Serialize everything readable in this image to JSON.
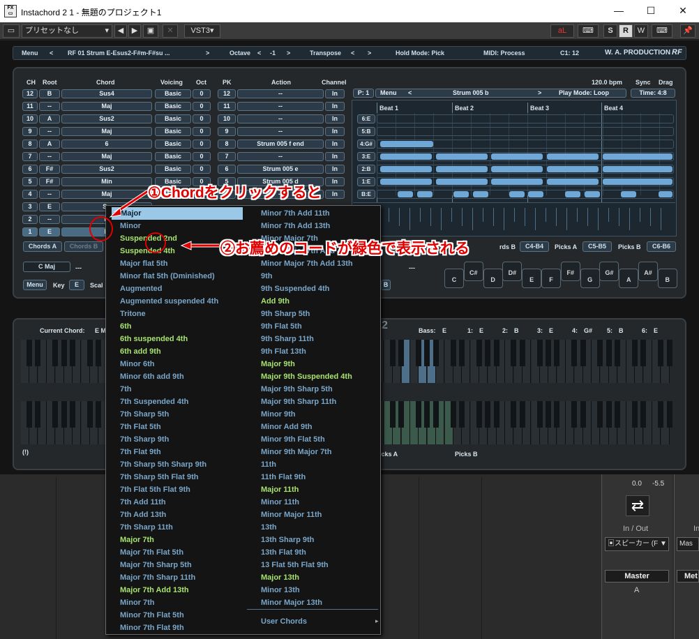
{
  "window": {
    "title": "Instachord 2 1 - 無題のプロジェクト1",
    "minimize": "—",
    "maximize": "☐",
    "close": "✕"
  },
  "toolbar": {
    "preset": "プリセットなし",
    "vst": "VST3▾",
    "s": "S",
    "r": "R",
    "w": "W"
  },
  "topstrip": {
    "menu": "Menu",
    "prev": "<",
    "preset": "RF 01 Strum E-Esus2-F#m-F#su ...",
    "next": ">",
    "octave": "Octave",
    "octave_value": "-1",
    "transpose": "Transpose",
    "hold_mode": "Hold Mode: Pick",
    "midi": "MIDI: Process",
    "c1": "C1: 12",
    "brand": "W. A. PRODUCTION",
    "brand_rf": "RF"
  },
  "headers": {
    "ch": "CH",
    "root": "Root",
    "chord": "Chord",
    "voicing": "Voicing",
    "oct": "Oct",
    "pk": "PK",
    "action": "Action",
    "channel": "Channel",
    "bpm": "120.0 bpm",
    "sync": "Sync",
    "drag": "Drag"
  },
  "rows": [
    {
      "ch": "12",
      "root": "B",
      "chord": "Sus4",
      "voicing": "Basic",
      "oct": "0",
      "pk": "12",
      "action": "--",
      "chan": "In"
    },
    {
      "ch": "11",
      "root": "--",
      "chord": "Maj",
      "voicing": "Basic",
      "oct": "0",
      "pk": "11",
      "action": "--",
      "chan": "In"
    },
    {
      "ch": "10",
      "root": "A",
      "chord": "Sus2",
      "voicing": "Basic",
      "oct": "0",
      "pk": "10",
      "action": "--",
      "chan": "In"
    },
    {
      "ch": "9",
      "root": "--",
      "chord": "Maj",
      "voicing": "Basic",
      "oct": "0",
      "pk": "9",
      "action": "--",
      "chan": "In"
    },
    {
      "ch": "8",
      "root": "A",
      "chord": "6",
      "voicing": "Basic",
      "oct": "0",
      "pk": "8",
      "action": "Strum 005 f end",
      "chan": "In"
    },
    {
      "ch": "7",
      "root": "--",
      "chord": "Maj",
      "voicing": "Basic",
      "oct": "0",
      "pk": "7",
      "action": "--",
      "chan": "In"
    },
    {
      "ch": "6",
      "root": "F#",
      "chord": "Sus2",
      "voicing": "Basic",
      "oct": "0",
      "pk": "6",
      "action": "Strum 005 e",
      "chan": "In"
    },
    {
      "ch": "5",
      "root": "F#",
      "chord": "Min",
      "voicing": "Basic",
      "oct": "0",
      "pk": "5",
      "action": "Strum 005 d",
      "chan": "In"
    },
    {
      "ch": "4",
      "root": "--",
      "chord": "Maj",
      "voicing": "Basic",
      "oct": "0",
      "pk": "4",
      "action": "--",
      "chan": "In"
    },
    {
      "ch": "3",
      "root": "E",
      "chord": "Su",
      "voicing": "",
      "oct": "",
      "pk": "",
      "action": "",
      "chan": ""
    },
    {
      "ch": "2",
      "root": "--",
      "chord": "M",
      "voicing": "",
      "oct": "",
      "pk": "",
      "action": "",
      "chan": ""
    },
    {
      "ch": "1",
      "root": "E",
      "chord": "M",
      "voicing": "",
      "oct": "",
      "pk": "",
      "action": "",
      "chan": ""
    }
  ],
  "pattern": {
    "p": "P: 1",
    "menu": "Menu",
    "prev": "<",
    "name": "Strum 005 b",
    "next": ">",
    "play_mode": "Play Mode: Loop",
    "time": "Time: 4:8",
    "beats": [
      "Beat 1",
      "Beat 2",
      "Beat 3",
      "Beat 4"
    ],
    "lanes": [
      "6:E",
      "5:B",
      "4:G#",
      "3:E",
      "2:B",
      "1:E",
      "B:E"
    ]
  },
  "lower_controls": {
    "chords_a": "Chords A",
    "chords_b": "Chords B",
    "rds_b": "rds B",
    "c4b4": "C4-B4",
    "picks_a": "Picks A",
    "c5b5": "C5-B5",
    "picks_b": "Picks B",
    "c6b6": "C6-B6",
    "cmaj": "C Maj",
    "dash1": "---",
    "dash2": "---",
    "menu": "Menu",
    "key": "Key",
    "key_value": "E",
    "scale": "Scal",
    "b_btn": "B"
  },
  "pick_keys": [
    "C",
    "C#",
    "D",
    "D#",
    "E",
    "F",
    "F#",
    "G",
    "G#",
    "A",
    "A#",
    "B"
  ],
  "keyboard": {
    "current_chord": "Current Chord:",
    "current_value": "E M",
    "fragment": "2",
    "bass": "Bass:",
    "bass_value": "E",
    "strings": [
      {
        "k": "1:",
        "v": "E"
      },
      {
        "k": "2:",
        "v": "B"
      },
      {
        "k": "3:",
        "v": "E"
      },
      {
        "k": "4:",
        "v": "G#"
      },
      {
        "k": "5:",
        "v": "B"
      },
      {
        "k": "6:",
        "v": "E"
      }
    ],
    "picks_a": "icks A",
    "picks_b": "Picks B",
    "help": "(!)"
  },
  "host": {
    "val1": "0.0",
    "val2": "-5.5",
    "inout": "In / Out",
    "inout2": "In",
    "speaker": "スピーカー (F ▼",
    "mas": "Mas",
    "master": "Master",
    "met": "Met",
    "a": "A"
  },
  "menu": {
    "col1": [
      {
        "t": "✓Major",
        "g": false,
        "sel": true
      },
      {
        "t": "Minor",
        "g": false
      },
      {
        "t": "Suspended 2nd",
        "g": true
      },
      {
        "t": "Suspended 4th",
        "g": true
      },
      {
        "t": "Major flat 5th",
        "g": false
      },
      {
        "t": "Minor flat 5th (Dminished)",
        "g": false
      },
      {
        "t": "Augmented",
        "g": false
      },
      {
        "t": "Augmented suspended 4th",
        "g": false
      },
      {
        "t": "Tritone",
        "g": false
      },
      {
        "t": "6th",
        "g": true
      },
      {
        "t": "6th suspended 4th",
        "g": true
      },
      {
        "t": "6th add 9th",
        "g": true
      },
      {
        "t": "Minor 6th",
        "g": false
      },
      {
        "t": "Minor 6th add 9th",
        "g": false
      },
      {
        "t": "7th",
        "g": false
      },
      {
        "t": "7th Suspended 4th",
        "g": false
      },
      {
        "t": "7th Sharp 5th",
        "g": false
      },
      {
        "t": "7th Flat 5th",
        "g": false
      },
      {
        "t": "7th Sharp 9th",
        "g": false
      },
      {
        "t": "7th Flat 9th",
        "g": false
      },
      {
        "t": "7th Sharp 5th Sharp 9th",
        "g": false
      },
      {
        "t": "7th Sharp 5th Flat 9th",
        "g": false
      },
      {
        "t": "7th Flat 5th Flat 9th",
        "g": false
      },
      {
        "t": "7th Add 11th",
        "g": false
      },
      {
        "t": "7th Add 13th",
        "g": false
      },
      {
        "t": "7th Sharp 11th",
        "g": false
      },
      {
        "t": "Major 7th",
        "g": true
      },
      {
        "t": "Major 7th Flat 5th",
        "g": false
      },
      {
        "t": "Major 7th Sharp 5th",
        "g": false
      },
      {
        "t": "Major 7th Sharp 11th",
        "g": false
      },
      {
        "t": "Major 7th Add 13th",
        "g": true
      },
      {
        "t": "Minor 7th",
        "g": false
      },
      {
        "t": "Minor 7th Flat 5th",
        "g": false
      },
      {
        "t": "Minor 7th Flat 9th",
        "g": false
      }
    ],
    "col2": [
      {
        "t": "Minor 7th Add 11th",
        "g": false
      },
      {
        "t": "Minor 7th Add 13th",
        "g": false
      },
      {
        "t": "Minor Major 7th",
        "g": false
      },
      {
        "t": "Minor Major 7th Add",
        "g": false
      },
      {
        "t": "Minor Major 7th Add 13th",
        "g": false
      },
      {
        "t": "9th",
        "g": false
      },
      {
        "t": "9th Suspended 4th",
        "g": false
      },
      {
        "t": "Add 9th",
        "g": true
      },
      {
        "t": "9th Sharp 5th",
        "g": false
      },
      {
        "t": "9th Flat 5th",
        "g": false
      },
      {
        "t": "9th Sharp 11th",
        "g": false
      },
      {
        "t": "9th Flat 13th",
        "g": false
      },
      {
        "t": "Major 9th",
        "g": true
      },
      {
        "t": "Major 9th Suspended 4th",
        "g": true
      },
      {
        "t": "Major 9th Sharp 5th",
        "g": false
      },
      {
        "t": "Major 9th Sharp 11th",
        "g": false
      },
      {
        "t": "Minor 9th",
        "g": false
      },
      {
        "t": "Minor Add 9th",
        "g": false
      },
      {
        "t": "Minor 9th Flat 5th",
        "g": false
      },
      {
        "t": "Minor 9th Major 7th",
        "g": false
      },
      {
        "t": "11th",
        "g": false
      },
      {
        "t": "11th Flat 9th",
        "g": false
      },
      {
        "t": "Major 11th",
        "g": true
      },
      {
        "t": "Minor 11th",
        "g": false
      },
      {
        "t": "Minor Major 11th",
        "g": false
      },
      {
        "t": "13th",
        "g": false
      },
      {
        "t": "13th Sharp 9th",
        "g": false
      },
      {
        "t": "13th Flat 9th",
        "g": false
      },
      {
        "t": "13 Flat 5th Flat 9th",
        "g": false
      },
      {
        "t": "Major 13th",
        "g": true
      },
      {
        "t": "Minor 13th",
        "g": false
      },
      {
        "t": "Minor Major 13th",
        "g": false
      }
    ],
    "user_chords": "User Chords",
    "submenu_arrow": "▸"
  },
  "annotations": {
    "a1": "①Chordをクリックすると",
    "a2": "②お薦めのコードが緑色で表示される"
  },
  "colors": {
    "green": "#a7e36d",
    "blue": "#79a6c9",
    "accent": "#6fa8d6",
    "annotation": "#e10000"
  }
}
